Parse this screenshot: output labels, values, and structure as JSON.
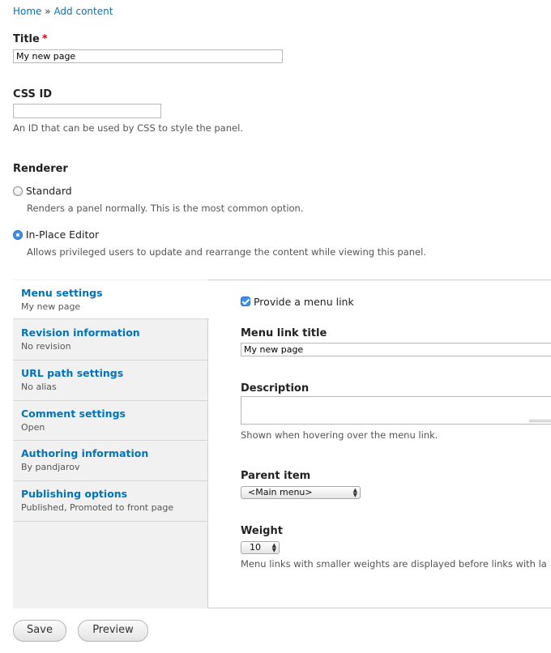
{
  "breadcrumb": {
    "home": "Home",
    "separator": "»",
    "current": "Add content"
  },
  "title_field": {
    "label": "Title",
    "required_mark": "*",
    "value": "My new page"
  },
  "css_id": {
    "label": "CSS ID",
    "value": "",
    "description": "An ID that can be used by CSS to style the panel."
  },
  "renderer": {
    "label": "Renderer",
    "options": [
      {
        "label": "Standard",
        "description": "Renders a panel normally. This is the most common option.",
        "selected": false
      },
      {
        "label": "In-Place Editor",
        "description": "Allows privileged users to update and rearrange the content while viewing this panel.",
        "selected": true
      }
    ]
  },
  "vertical_tabs": [
    {
      "title": "Menu settings",
      "summary": "My new page",
      "selected": true
    },
    {
      "title": "Revision information",
      "summary": "No revision"
    },
    {
      "title": "URL path settings",
      "summary": "No alias"
    },
    {
      "title": "Comment settings",
      "summary": "Open"
    },
    {
      "title": "Authoring information",
      "summary": "By pandjarov"
    },
    {
      "title": "Publishing options",
      "summary": "Published, Promoted to front page"
    }
  ],
  "menu_settings": {
    "provide_link_label": "Provide a menu link",
    "provide_link_checked": true,
    "link_title_label": "Menu link title",
    "link_title_value": "My new page",
    "description_label": "Description",
    "description_value": "",
    "description_help": "Shown when hovering over the menu link.",
    "parent_label": "Parent item",
    "parent_value": "<Main menu>",
    "weight_label": "Weight",
    "weight_value": "10",
    "weight_help": "Menu links with smaller weights are displayed before links with la"
  },
  "actions": {
    "save": "Save",
    "preview": "Preview"
  },
  "colors": {
    "link": "#0074bd",
    "required": "#ee0000",
    "accent": "#3b8ff0"
  }
}
